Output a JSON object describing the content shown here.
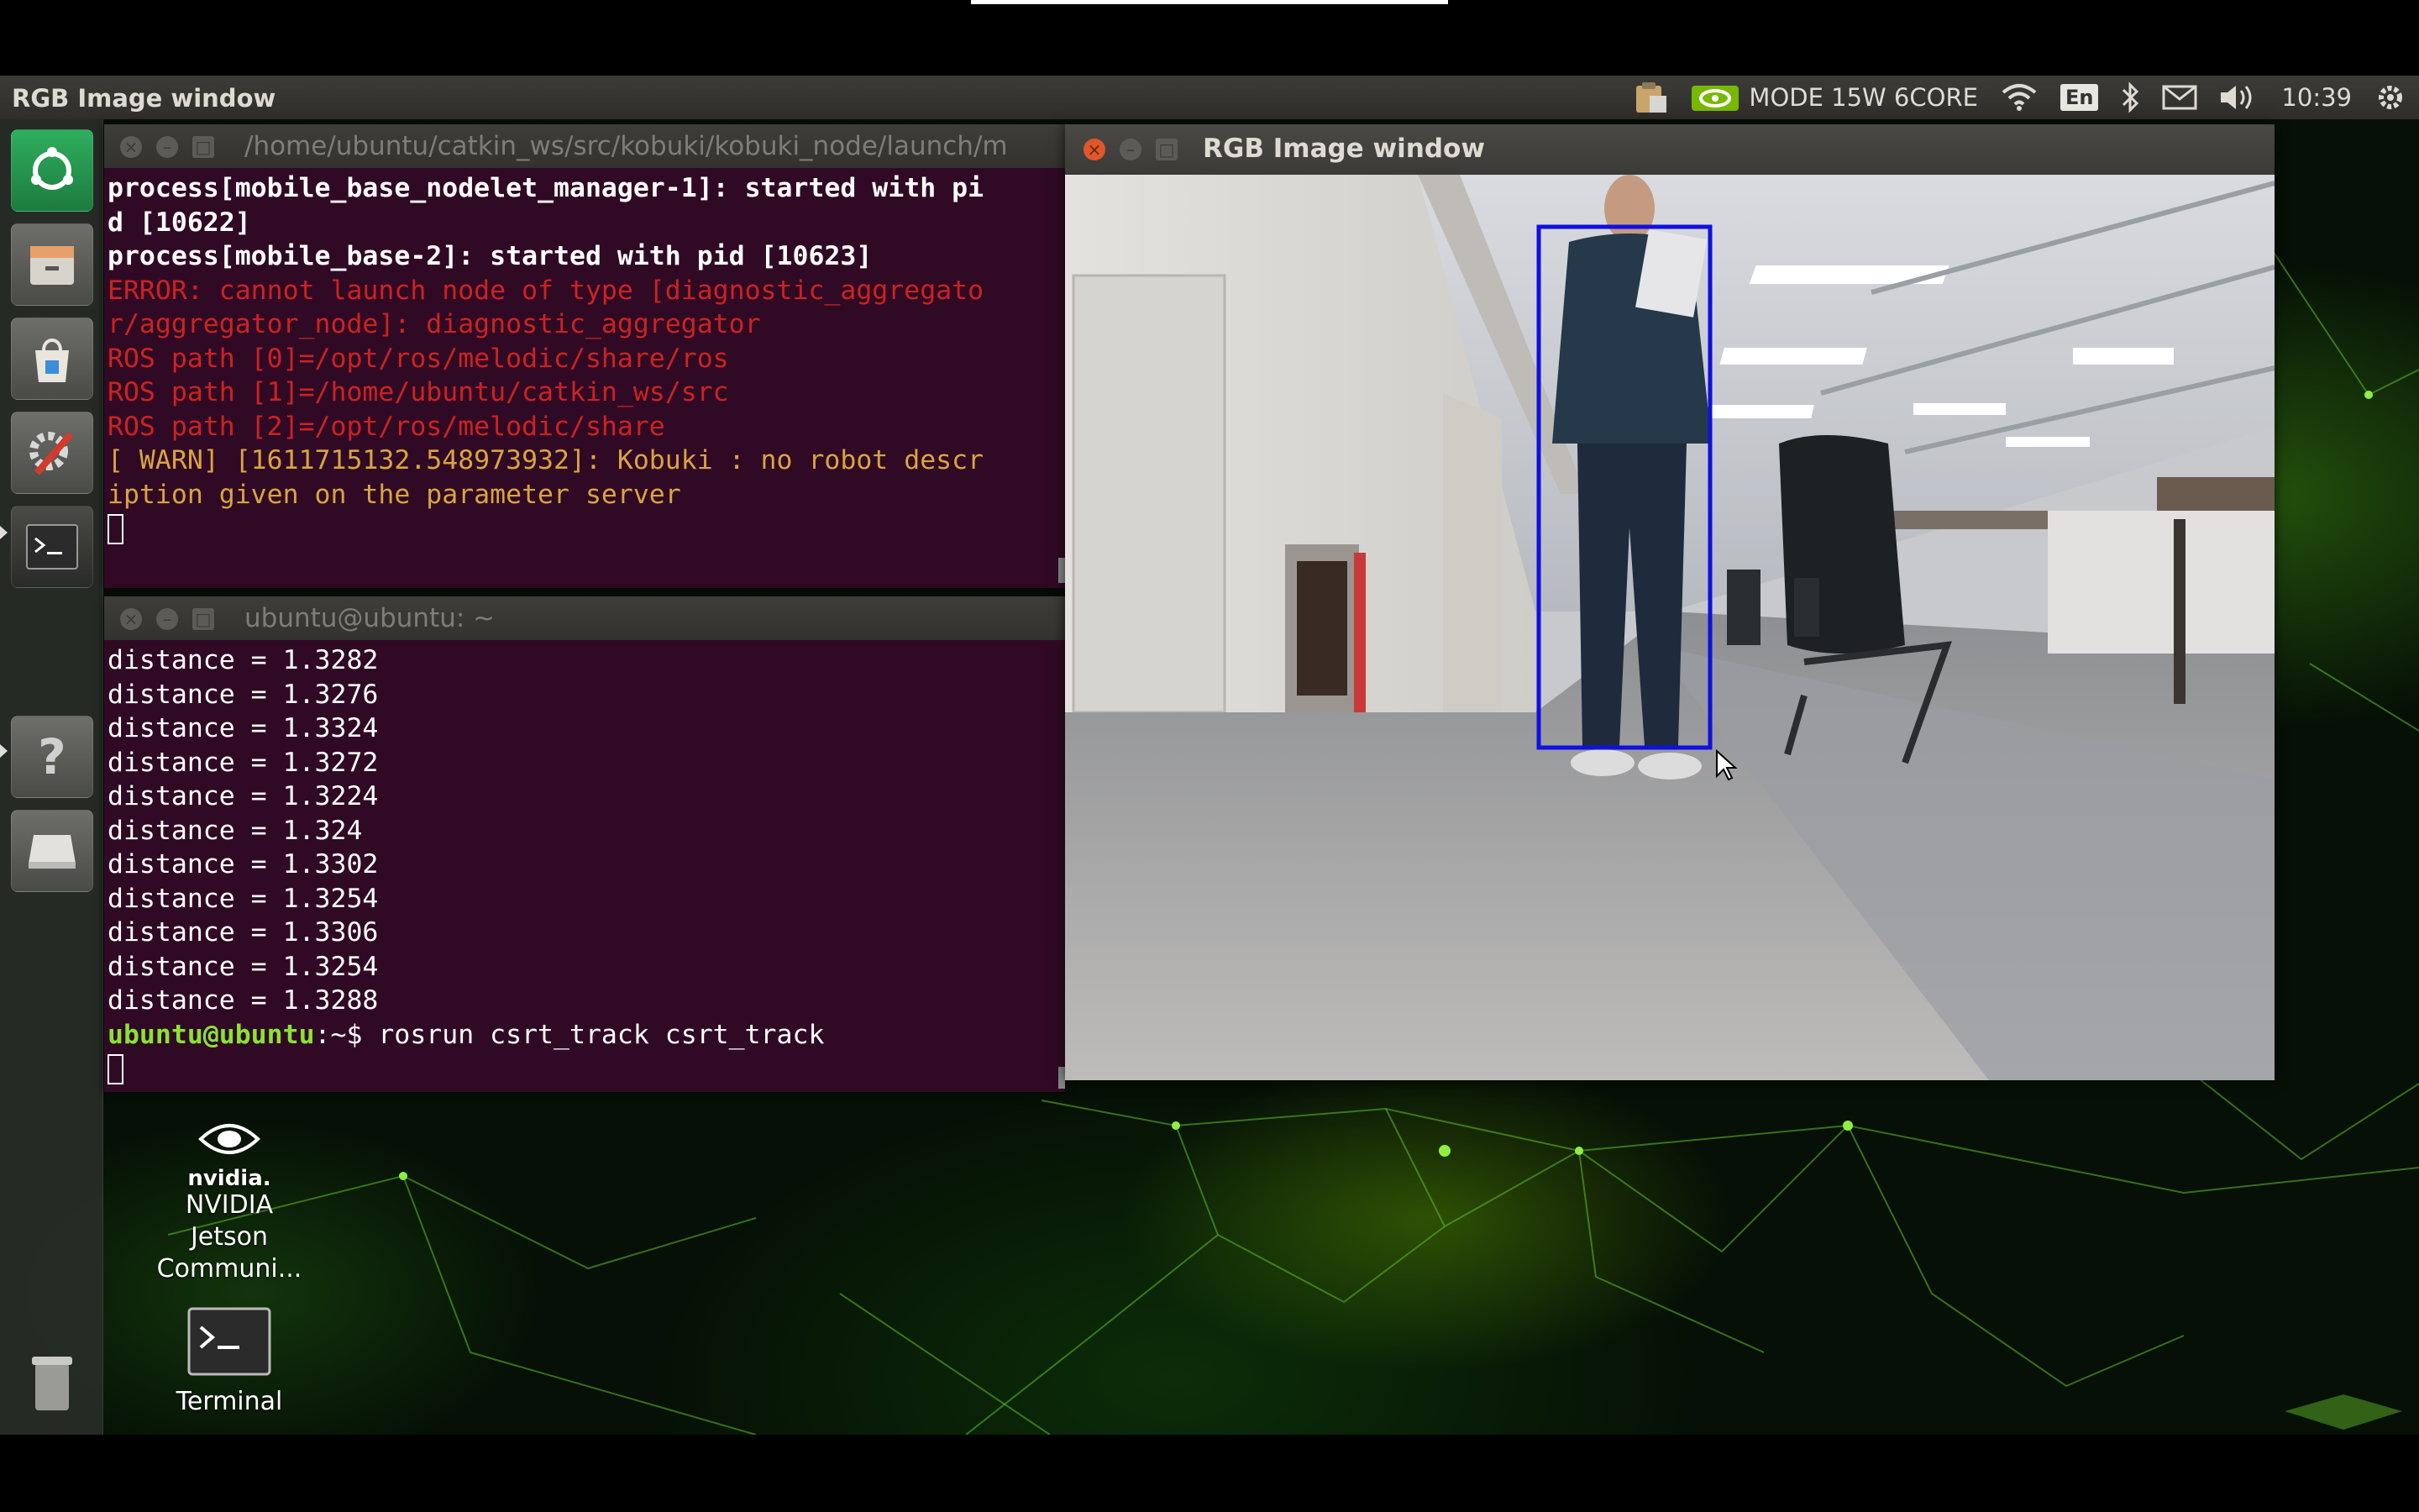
{
  "panel": {
    "app_title": "RGB Image window",
    "power_mode": "MODE 15W 6CORE",
    "keyboard_layout": "En",
    "clock": "10:39"
  },
  "launcher": {
    "items": [
      "ubuntu-logo",
      "files",
      "software-center",
      "system-settings",
      "terminal",
      "help",
      "drive"
    ],
    "trash": "trash"
  },
  "terminal_top": {
    "title": "/home/ubuntu/catkin_ws/src/kobuki/kobuki_node/launch/m",
    "lines": [
      {
        "text": "process[mobile_base_nodelet_manager-1]: started with pi",
        "style": "bold"
      },
      {
        "text": "d [10622]",
        "style": "bold"
      },
      {
        "text": "process[mobile_base-2]: started with pid [10623]",
        "style": "bold"
      },
      {
        "text": "ERROR: cannot launch node of type [diagnostic_aggregato",
        "style": "err"
      },
      {
        "text": "r/aggregator_node]: diagnostic_aggregator",
        "style": "err"
      },
      {
        "text": "ROS path [0]=/opt/ros/melodic/share/ros",
        "style": "err"
      },
      {
        "text": "ROS path [1]=/home/ubuntu/catkin_ws/src",
        "style": "err"
      },
      {
        "text": "ROS path [2]=/opt/ros/melodic/share",
        "style": "err"
      },
      {
        "text": "[ WARN] [1611715132.548973932]: Kobuki : no robot descr",
        "style": "warn"
      },
      {
        "text": "iption given on the parameter server",
        "style": "warn"
      }
    ]
  },
  "terminal_bottom": {
    "title": "ubuntu@ubuntu: ~",
    "lines": [
      "distance = 1.3282",
      "distance = 1.3276",
      "distance = 1.3324",
      "distance = 1.3272",
      "distance = 1.3224",
      "distance = 1.324",
      "distance = 1.3302",
      "distance = 1.3254",
      "distance = 1.3306",
      "distance = 1.3254",
      "distance = 1.3288"
    ],
    "prompt_user": "ubuntu@ubuntu",
    "prompt_path": ":~$ ",
    "command": "rosrun csrt_track csrt_track"
  },
  "rgb_window": {
    "title": "RGB Image window",
    "tracking_box_color": "#1010e0"
  },
  "desktop_icons": [
    {
      "label_lines": [
        "NVIDIA",
        "Jetson",
        "Communi..."
      ],
      "logo_text": "nvidia."
    },
    {
      "label_lines": [
        "Terminal"
      ]
    }
  ],
  "colors": {
    "terminal_bg": "#300a24",
    "accent": "#76b900",
    "close_button": "#e0562b"
  }
}
